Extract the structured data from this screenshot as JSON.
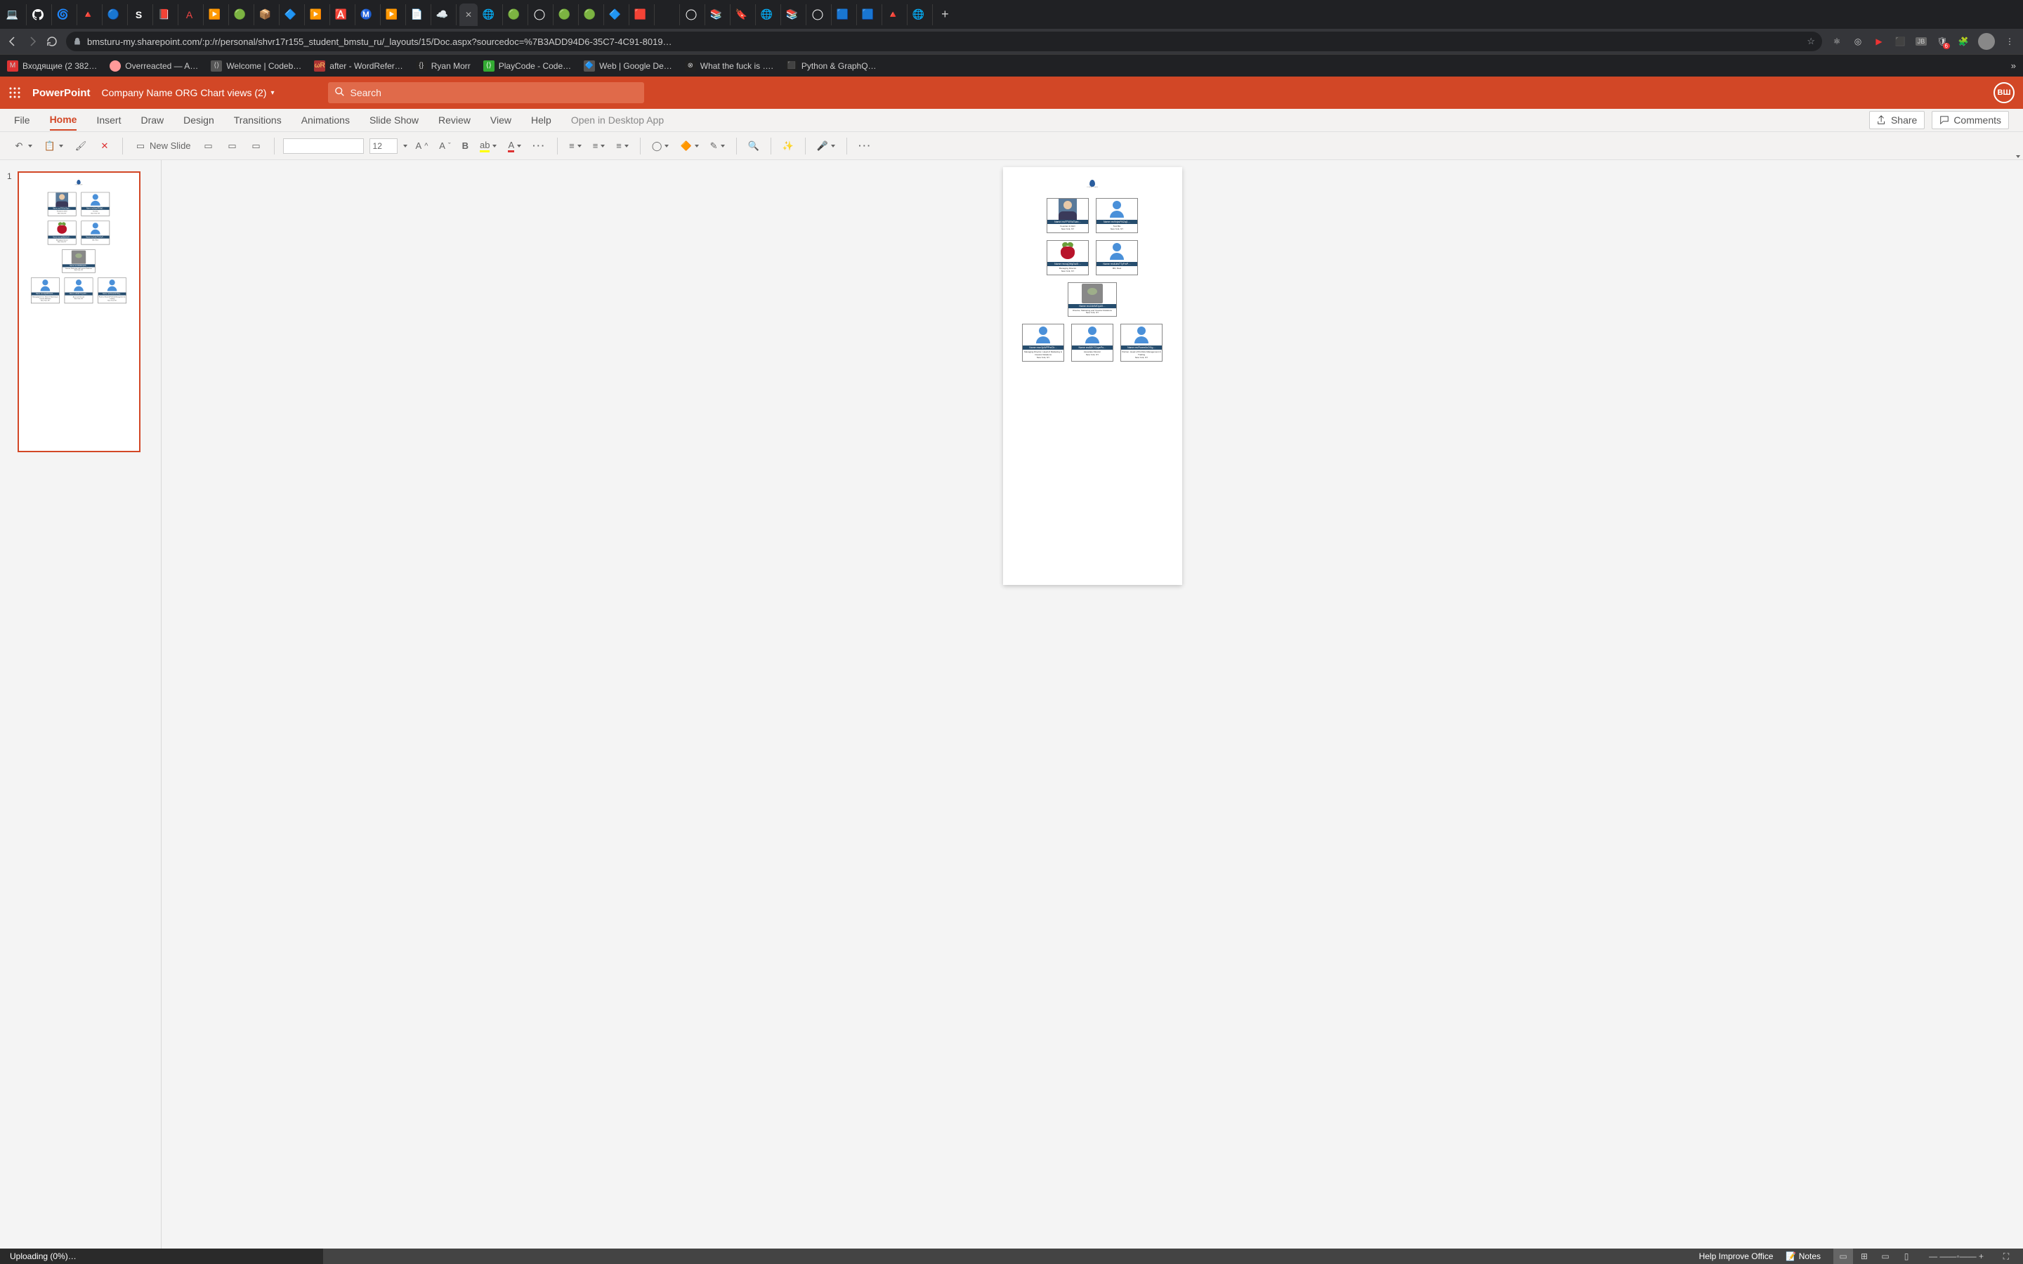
{
  "browser": {
    "url": "bmsturu-my.sharepoint.com/:p:/r/personal/shvr17r155_student_bmstu_ru/_layouts/15/Doc.aspx?sourcedoc=%7B3ADD94D6-35C7-4C91-8019…",
    "bookmarks": [
      "Входящие (2 382…",
      "Overreacted — A…",
      "Welcome | Codeb…",
      "after - WordRefer…",
      "Ryan Morr",
      "PlayCode - Code…",
      "Web  |  Google De…",
      "What the fuck is ….",
      "Python & GraphQ…"
    ],
    "ext_badge": "6"
  },
  "pp": {
    "brand": "PowerPoint",
    "doc_title": "Company Name ORG Chart views (2)",
    "search_placeholder": "Search",
    "user_initials": "ВШ",
    "ribbon": [
      "File",
      "Home",
      "Insert",
      "Draw",
      "Design",
      "Transitions",
      "Animations",
      "Slide Show",
      "Review",
      "View",
      "Help"
    ],
    "open_desktop": "Open in Desktop App",
    "share": "Share",
    "comments": "Comments",
    "new_slide": "New Slide",
    "font_size": "12",
    "slide_num": "1"
  },
  "org": {
    "logo": "COMPANY NAME",
    "level1": [
      {
        "name": "Name recFFWVaToan…",
        "role": "Founder & CEO",
        "loc": "New York, NY",
        "img": "boss"
      },
      {
        "name": "Name rec9vlpvPAZaj1…",
        "role": "Test Bio",
        "loc": "New York, NY",
        "img": "generic"
      }
    ],
    "level2": [
      {
        "name": "Name recxqQMyDw2I…",
        "role": "Managing Director",
        "loc": "New York, NY",
        "img": "raspberry"
      },
      {
        "name": "Name rec4ufwTTyFmP…",
        "role": "MD, Rest",
        "loc": "",
        "img": "generic"
      }
    ],
    "level3": [
      {
        "name": "Name rec14iriMOpU0…",
        "role": "Director, Marketing and Investor Relations",
        "loc": "New York, NY",
        "img": "yoda"
      }
    ],
    "level4": [
      {
        "name": "Name recn3pWPPwClr…",
        "role": "Managing Director- Head of Marketing & Investor Relations",
        "loc": "New York, NY",
        "img": "generic"
      },
      {
        "name": "Name rec8JK7CxpePo…",
        "role": "Associate Director",
        "loc": "New York, NY",
        "img": "generic"
      },
      {
        "name": "Name recFkwex0cOGg…",
        "role": "Partner- Head of Portfolio Management & Trading",
        "loc": "New York, NY",
        "img": "generic"
      }
    ]
  },
  "status": {
    "upload": "Uploading (0%)…",
    "help": "Help Improve Office",
    "notes": "Notes"
  }
}
